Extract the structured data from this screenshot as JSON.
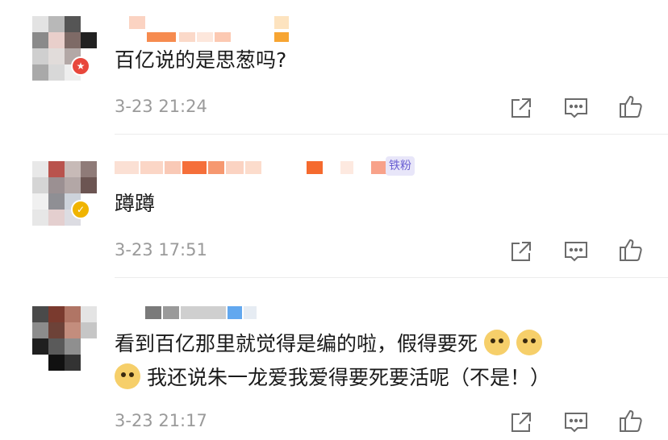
{
  "comments": [
    {
      "text": "百亿说的是思葱吗?",
      "time": "3-23 21:24",
      "badge_color": "#e8473c"
    },
    {
      "fan_tag": "铁粉",
      "text": "蹲蹲",
      "time": "3-23 17:51",
      "badge_color": "#f0b400"
    },
    {
      "text_line1": "看到百亿那里就觉得是编的啦，假得要死",
      "text_line2": "我还说朱一龙爱我爱得要死要活呢（不是！）",
      "emoji_name": "doge-emoji",
      "time": "3-23 21:17"
    }
  ],
  "icons": [
    "share-icon",
    "comment-icon",
    "like-icon"
  ],
  "colors": {
    "icon": "#6b6b6b",
    "divider": "#ececec",
    "time": "#9a9a9a",
    "text": "#1a1a1a"
  }
}
